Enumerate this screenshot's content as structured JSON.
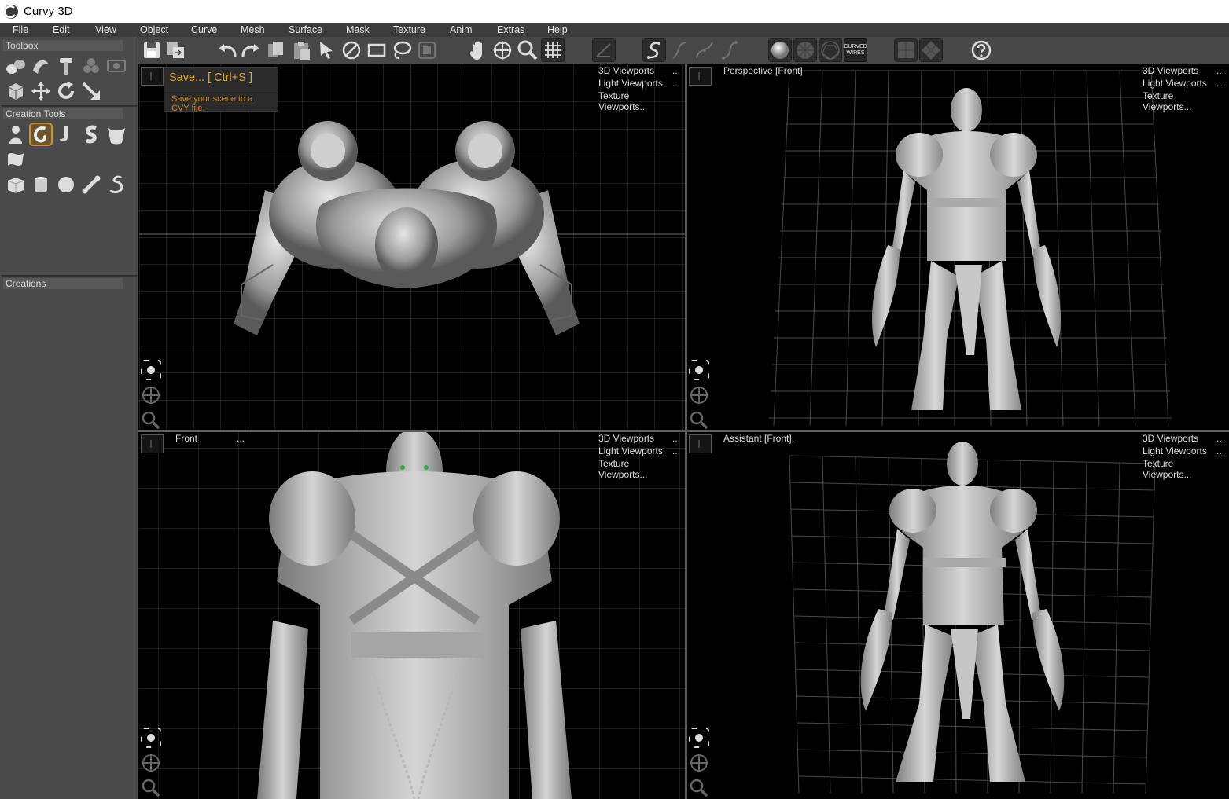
{
  "window": {
    "title": "Curvy 3D",
    "icon": "curvy-logo-icon"
  },
  "menu": [
    "File",
    "Edit",
    "View",
    "Object",
    "Curve",
    "Mesh",
    "Surface",
    "Mask",
    "Texture",
    "Anim",
    "Extras",
    "Help"
  ],
  "left_panel": {
    "toolbox_header": "Toolbox",
    "creation_tools_header": "Creation Tools",
    "creations_header": "Creations"
  },
  "toolbar": {
    "curved_wires_label_1": "CURVED",
    "curved_wires_label_2": "WIRES"
  },
  "tooltip": {
    "title": "Save...   [ Ctrl+S ]",
    "description": "Save your scene to a CVY file."
  },
  "viewports": {
    "top_left": {
      "label": "",
      "menu": [
        "3D Viewports",
        "Light Viewports",
        "Texture Viewports..."
      ]
    },
    "top_right": {
      "label": "Perspective [Front]",
      "menu": [
        "3D Viewports",
        "Light Viewports",
        "Texture Viewports..."
      ]
    },
    "bottom_left": {
      "label": "Front",
      "label_dots": "...",
      "menu": [
        "3D Viewports",
        "Light Viewports",
        "Texture Viewports..."
      ]
    },
    "bottom_right": {
      "label": "Assistant [Front].",
      "menu": [
        "3D Viewports",
        "Light Viewports",
        "Texture Viewports..."
      ]
    }
  },
  "menu_dots": "...",
  "colors": {
    "accent": "#c8952b",
    "panel": "#4a4a4a",
    "toolbar": "#474747",
    "grid": "#3b3b3b"
  }
}
